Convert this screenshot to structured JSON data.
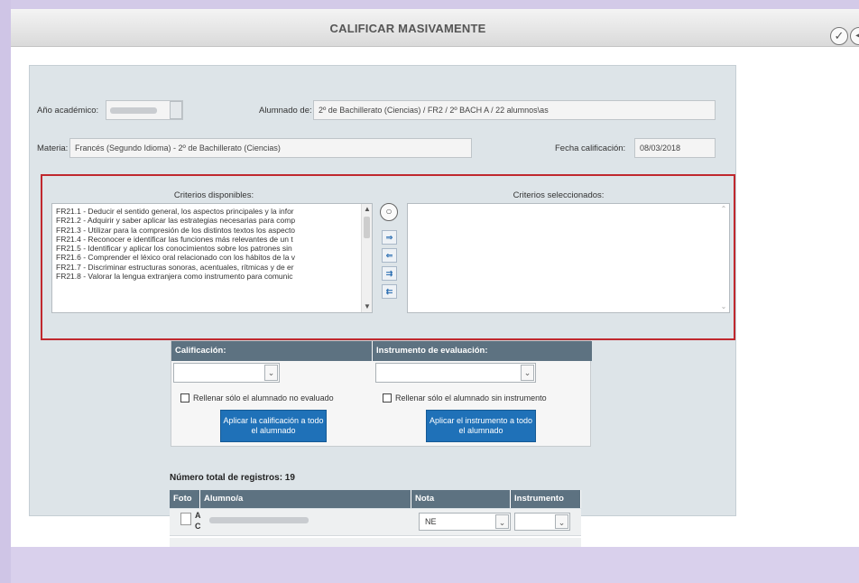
{
  "header": {
    "title": "CALIFICAR MASIVAMENTE",
    "icons": [
      "check-circle-icon",
      "back-circle-icon"
    ]
  },
  "form": {
    "academic_year_label": "Año académico:",
    "students_label": "Alumnado de:",
    "students_value": "2º de Bachillerato (Ciencias) / FR2 / 2º BACH A / 22 alumnos\\as",
    "subject_label": "Materia:",
    "subject_value": "Francés (Segundo Idioma) - 2º de Bachillerato (Ciencias)",
    "date_label": "Fecha calificación:",
    "date_value": "08/03/2018"
  },
  "criteria": {
    "available_title": "Criterios disponibles:",
    "selected_title": "Criterios seleccionados:",
    "available_items": [
      "FR21.1 - Deducir el sentido general, los aspectos principales y la infor",
      "FR21.2 - Adquirir y saber aplicar las estrategias necesarias para comp",
      "FR21.3 - Utilizar para la compresión de los distintos textos los aspecto",
      "FR21.4 - Reconocer e identificar las funciones más relevantes de un t",
      "FR21.5 - Identificar y aplicar los conocimientos sobre los patrones sin",
      "FR21.6 - Comprender el léxico oral relacionado con los hábitos de la v",
      "FR21.7 - Discriminar estructuras sonoras, acentuales, rítmicas y de er",
      "FR21.8 - Valorar la lengua extranjera como instrumento para comunic"
    ],
    "transfer_buttons": [
      "⇒",
      "⇐",
      "⇉",
      "⇇"
    ]
  },
  "grading": {
    "grade_header": "Calificación:",
    "instrument_header": "Instrumento de evaluación:",
    "fill_unevaluated_label": "Rellenar sólo el alumnado no evaluado",
    "fill_no_instrument_label": "Rellenar sólo el alumnado sin instrumento",
    "apply_grade_button": "Aplicar la calificación a todo el alumnado",
    "apply_instrument_button": "Aplicar el instrumento a todo el alumnado"
  },
  "records": {
    "total_label": "Número total de registros: 19",
    "columns": [
      "Foto",
      "Alumno/a",
      "Nota",
      "Instrumento"
    ],
    "rows": [
      {
        "tag_a": "A",
        "tag_c": "C",
        "grade": "NE",
        "instrument": ""
      }
    ]
  }
}
